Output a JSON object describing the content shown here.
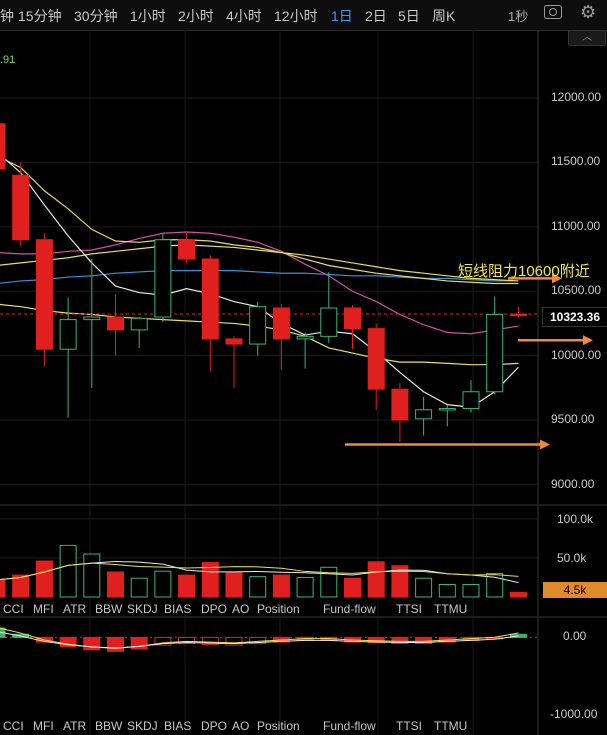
{
  "toolbar": {
    "timeframes": [
      "钟",
      "15分钟",
      "30分钟",
      "1小时",
      "2小时",
      "4小时",
      "12小时",
      "1日",
      "2日",
      "5日",
      "周K"
    ],
    "active": "1日",
    "interval": "1秒"
  },
  "ma_readout": ".91",
  "price_axis": [
    "12000.00",
    "11500.00",
    "11000.00",
    "10500.00",
    "10000.00",
    "9500.00",
    "9000.00"
  ],
  "current_price": "10323.36",
  "annotation": "短线阻力10600附近",
  "volume_axis": [
    "100.0k",
    "50.0k"
  ],
  "volume_tag": "4.5k",
  "osc_axis": [
    "0.00",
    "-1000.00"
  ],
  "indicators": [
    "CCI",
    "MFI",
    "ATR",
    "BBW",
    "SKDJ",
    "BIAS",
    "DPO",
    "AO",
    "Position",
    "Fund-flow",
    "TTSI",
    "TTMU"
  ],
  "colors": {
    "up": "#3cb371",
    "down": "#e01f1f",
    "accent": "#4a90ff",
    "arrow": "#f08a3a",
    "annotation": "#f5e64a"
  },
  "chart_data": {
    "type": "candlestick",
    "ylim": [
      8900,
      12300
    ],
    "candles": [
      {
        "o": 11800,
        "h": 11850,
        "l": 11400,
        "c": 11450
      },
      {
        "o": 11400,
        "h": 11500,
        "l": 10850,
        "c": 10900
      },
      {
        "o": 10900,
        "h": 10950,
        "l": 9920,
        "c": 10050
      },
      {
        "o": 10050,
        "h": 10450,
        "l": 9520,
        "c": 10280
      },
      {
        "o": 10280,
        "h": 10750,
        "l": 9750,
        "c": 10300
      },
      {
        "o": 10300,
        "h": 10480,
        "l": 10000,
        "c": 10200
      },
      {
        "o": 10200,
        "h": 10300,
        "l": 10060,
        "c": 10290
      },
      {
        "o": 10300,
        "h": 10950,
        "l": 10260,
        "c": 10900
      },
      {
        "o": 10900,
        "h": 10960,
        "l": 10720,
        "c": 10750
      },
      {
        "o": 10750,
        "h": 10780,
        "l": 9880,
        "c": 10130
      },
      {
        "o": 10130,
        "h": 10150,
        "l": 9750,
        "c": 10090
      },
      {
        "o": 10090,
        "h": 10420,
        "l": 10000,
        "c": 10380
      },
      {
        "o": 10370,
        "h": 10400,
        "l": 9890,
        "c": 10130
      },
      {
        "o": 10130,
        "h": 10180,
        "l": 9900,
        "c": 10150
      },
      {
        "o": 10150,
        "h": 10650,
        "l": 10100,
        "c": 10370
      },
      {
        "o": 10370,
        "h": 10390,
        "l": 10050,
        "c": 10210
      },
      {
        "o": 10210,
        "h": 10250,
        "l": 9580,
        "c": 9740
      },
      {
        "o": 9740,
        "h": 9790,
        "l": 9330,
        "c": 9500
      },
      {
        "o": 9510,
        "h": 9680,
        "l": 9380,
        "c": 9580
      },
      {
        "o": 9580,
        "h": 9620,
        "l": 9450,
        "c": 9590
      },
      {
        "o": 9590,
        "h": 9810,
        "l": 9560,
        "c": 9720
      },
      {
        "o": 9720,
        "h": 10460,
        "l": 9700,
        "c": 10320
      },
      {
        "o": 10323,
        "h": 10380,
        "l": 10300,
        "c": 10323
      }
    ],
    "ma_fast": [
      11580,
      11420,
      11170,
      10930,
      10720,
      10540,
      10490,
      10470,
      10520,
      10480,
      10420,
      10380,
      10250,
      10160,
      10190,
      10170,
      10030,
      9870,
      9720,
      9620,
      9600,
      9720,
      9910
    ],
    "ma_slow": [
      11550,
      11460,
      11280,
      11140,
      10980,
      10890,
      10880,
      10900,
      10900,
      10890,
      10860,
      10840,
      10800,
      10750,
      10700,
      10670,
      10640,
      10620,
      10600,
      10580,
      10570,
      10560,
      10560
    ],
    "ma_pink": [
      10800,
      10790,
      10790,
      10810,
      10820,
      10860,
      10910,
      10950,
      10960,
      10950,
      10920,
      10880,
      10810,
      10710,
      10620,
      10500,
      10420,
      10320,
      10240,
      10180,
      10170,
      10200,
      10230
    ],
    "ma_blue": [
      10560,
      10580,
      10590,
      10610,
      10620,
      10640,
      10650,
      10660,
      10660,
      10660,
      10660,
      10650,
      10640,
      10640,
      10630,
      10620,
      10620,
      10610,
      10600,
      10600,
      10590,
      10580,
      10580
    ],
    "ma_yellow2": [
      10700,
      10720,
      10740,
      10760,
      10790,
      10810,
      10830,
      10850,
      10860,
      10850,
      10840,
      10820,
      10800,
      10780,
      10750,
      10720,
      10690,
      10660,
      10640,
      10620,
      10600,
      10590,
      10580
    ],
    "ma_lower": [
      10400,
      10380,
      10350,
      10330,
      10320,
      10300,
      10290,
      10280,
      10270,
      10260,
      10250,
      10230,
      10200,
      10150,
      10060,
      10020,
      9980,
      9950,
      9950,
      9940,
      9930,
      9930,
      9940
    ],
    "volume": [
      22,
      28,
      46,
      66,
      55,
      32,
      24,
      33,
      28,
      44,
      32,
      26,
      28,
      25,
      38,
      24,
      45,
      40,
      24,
      16,
      16,
      30,
      6
    ],
    "volume_ylim": [
      0,
      110
    ],
    "osc": [
      120,
      40,
      -60,
      -120,
      -160,
      -180,
      -150,
      -100,
      -80,
      -90,
      -100,
      -80,
      -60,
      -40,
      -40,
      -60,
      -70,
      -80,
      -80,
      -60,
      -40,
      -20,
      40
    ],
    "osc_ylim": [
      -1000,
      250
    ]
  }
}
